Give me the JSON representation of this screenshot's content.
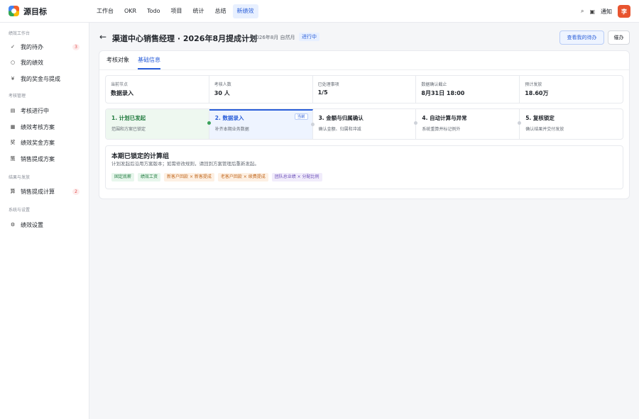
{
  "app": {
    "name": "源目标"
  },
  "nav": [
    "工作台",
    "OKR",
    "Todo",
    "项目",
    "统计",
    "总结",
    "新绩效"
  ],
  "topbar": {
    "search_icon": "⌕",
    "panel_icon": "▣",
    "notice": "通知",
    "avatar": "李"
  },
  "sidebar": {
    "groups": [
      {
        "label": "绩效工作台",
        "items": [
          {
            "icon": "✓",
            "icon_name": "check-icon",
            "label": "我的待办",
            "badge": "3"
          },
          {
            "icon": "○",
            "icon_name": "circle-icon",
            "label": "我的绩效"
          },
          {
            "icon": "¥",
            "icon_name": "yen-icon",
            "label": "我的奖金与提成"
          }
        ]
      },
      {
        "label": "考核管理",
        "items": [
          {
            "icon": "▤",
            "icon_name": "list-icon",
            "label": "考核进行中"
          },
          {
            "icon": "▦",
            "icon_name": "grid-icon",
            "label": "绩效考核方案"
          },
          {
            "icon": "奖",
            "icon_name": "bonus-icon",
            "label": "绩效奖金方案"
          },
          {
            "icon": "策",
            "icon_name": "policy-icon",
            "label": "销售提成方案"
          }
        ]
      },
      {
        "label": "结果与发放",
        "items": [
          {
            "icon": "算",
            "icon_name": "calc-icon",
            "label": "销售提成计算",
            "badge": "2"
          }
        ]
      },
      {
        "label": "系统与设置",
        "items": [
          {
            "icon": "⚙",
            "icon_name": "gear-icon",
            "label": "绩效设置"
          }
        ]
      }
    ]
  },
  "header": {
    "back": "←",
    "title": "渠道中心销售经理 · 2026年8月提成计划",
    "period": "2026年8月  自然月",
    "status": "进行中",
    "primary_btn": "查看我的待办",
    "secondary_btn": "催办"
  },
  "tabs": [
    {
      "label": "考核对象",
      "active": false
    },
    {
      "label": "基础信息",
      "active": true
    }
  ],
  "stats": [
    {
      "label": "当前节点",
      "value": "数据录入"
    },
    {
      "label": "考核人数",
      "value": "30 人"
    },
    {
      "label": "已处理事项",
      "value": "1/5"
    },
    {
      "label": "数据确认截止",
      "value": "8月31日 18:00"
    },
    {
      "label": "预计发放",
      "value": "18.60万"
    }
  ],
  "steps": [
    {
      "title": "1. 计划已发起",
      "desc": "范围和方案已锁定",
      "state": "done"
    },
    {
      "title": "2. 数据录入",
      "desc": "补齐本期业务数据",
      "state": "current",
      "tag": "当前"
    },
    {
      "title": "3. 金额与归属确认",
      "desc": "确认金额、归属和冲减",
      "state": "todo"
    },
    {
      "title": "4. 自动计算与异常",
      "desc": "系统重算并标记例外",
      "state": "todo"
    },
    {
      "title": "5. 复核锁定",
      "desc": "确认结果并交付发放",
      "state": "todo"
    }
  ],
  "calc": {
    "title": "本期已锁定的计算组",
    "desc": "计划发起后沿用方案版本；如需修改规则，请回到方案管理后重新发起。",
    "chips": [
      {
        "label": "固定底薪",
        "color": "green"
      },
      {
        "label": "绩效工资",
        "color": "green"
      },
      {
        "label": "新客户回款 × 新客提成",
        "color": "orange"
      },
      {
        "label": "老客户回款 × 续费提成",
        "color": "orange"
      },
      {
        "label": "团队总业绩 × 分配比例",
        "color": "purple"
      }
    ]
  }
}
